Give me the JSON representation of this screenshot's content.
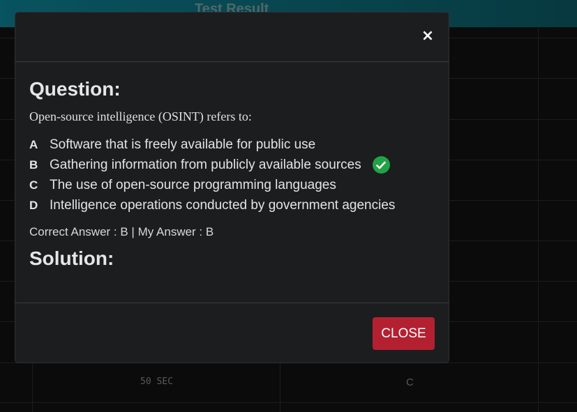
{
  "background": {
    "header_title": "Test Result",
    "row_time": "50 SEC",
    "row_answer": "C"
  },
  "modal": {
    "close_icon": "×",
    "question_heading": "Question:",
    "question_text": "Open-source intelligence (OSINT) refers to:",
    "options": [
      {
        "letter": "A",
        "text": "Software that is freely available for public use"
      },
      {
        "letter": "B",
        "text": "Gathering information from publicly available sources"
      },
      {
        "letter": "C",
        "text": "The use of open-source programming languages"
      },
      {
        "letter": "D",
        "text": "Intelligence operations conducted by government agencies"
      }
    ],
    "answer_summary": "Correct Answer : B | My Answer : B",
    "solution_heading": "Solution:",
    "close_button": "CLOSE"
  },
  "colors": {
    "correct": "#22a246",
    "danger": "#b32131",
    "header_accent": "#0b6f80"
  },
  "icons": {
    "close": "close-icon",
    "correct": "check-circle-icon"
  }
}
